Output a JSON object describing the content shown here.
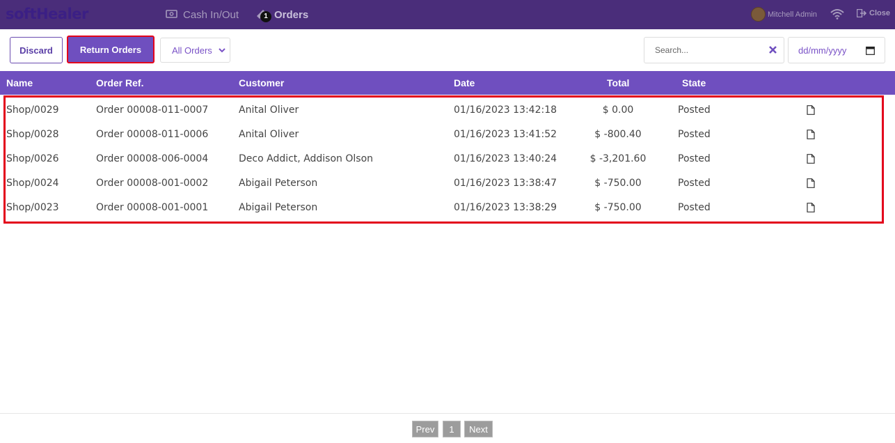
{
  "app": {
    "logo_text": "softHealer"
  },
  "nav": {
    "cash": {
      "label": "Cash In/Out",
      "icon": "cash-icon"
    },
    "orders": {
      "label": "Orders",
      "badge": "1",
      "icon": "ticket-icon"
    }
  },
  "user": {
    "name": "Mitchell Admin"
  },
  "close_label": "Close",
  "toolbar": {
    "discard_label": "Discard",
    "return_label": "Return Orders",
    "filter_value": "All Orders",
    "search_placeholder": "Search...",
    "date_placeholder": "dd/mm/yyyy"
  },
  "table": {
    "headers": {
      "name": "Name",
      "ref": "Order Ref.",
      "customer": "Customer",
      "date": "Date",
      "total": "Total",
      "state": "State"
    },
    "rows": [
      {
        "name": "Shop/0029",
        "ref": "Order 00008-011-0007",
        "customer": "Anital Oliver",
        "date": "01/16/2023 13:42:18",
        "total": "$ 0.00",
        "state": "Posted"
      },
      {
        "name": "Shop/0028",
        "ref": "Order 00008-011-0006",
        "customer": "Anital Oliver",
        "date": "01/16/2023 13:41:52",
        "total": "$ -800.40",
        "state": "Posted"
      },
      {
        "name": "Shop/0026",
        "ref": "Order 00008-006-0004",
        "customer": "Deco Addict, Addison Olson",
        "date": "01/16/2023 13:40:24",
        "total": "$ -3,201.60",
        "state": "Posted"
      },
      {
        "name": "Shop/0024",
        "ref": "Order 00008-001-0002",
        "customer": "Abigail Peterson",
        "date": "01/16/2023 13:38:47",
        "total": "$ -750.00",
        "state": "Posted"
      },
      {
        "name": "Shop/0023",
        "ref": "Order 00008-001-0001",
        "customer": "Abigail Peterson",
        "date": "01/16/2023 13:38:29",
        "total": "$ -750.00",
        "state": "Posted"
      }
    ]
  },
  "pagination": {
    "prev_label": "Prev",
    "page": "1",
    "next_label": "Next"
  },
  "colors": {
    "topbar": "#4a2d7a",
    "accent": "#6f4fbf",
    "highlight": "#e3001b"
  }
}
